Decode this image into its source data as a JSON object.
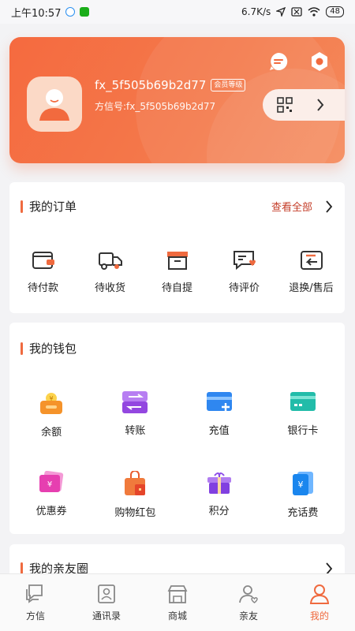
{
  "status_bar": {
    "time": "上午10:57",
    "speed": "6.7K/s",
    "battery": "48"
  },
  "profile": {
    "username": "fx_5f505b69b2d77",
    "member_tag": "会员等级",
    "id_line": "方信号:fx_5f505b69b2d77"
  },
  "orders": {
    "title": "我的订单",
    "view_all": "查看全部",
    "items": [
      {
        "label": "待付款",
        "icon": "wallet-icon"
      },
      {
        "label": "待收货",
        "icon": "delivery-truck-icon"
      },
      {
        "label": "待自提",
        "icon": "box-icon"
      },
      {
        "label": "待评价",
        "icon": "review-heart-icon"
      },
      {
        "label": "退换/售后",
        "icon": "return-icon"
      }
    ]
  },
  "wallet": {
    "title": "我的钱包",
    "items": [
      {
        "label": "余额",
        "icon": "balance-wallet-icon",
        "color": "#f5a623"
      },
      {
        "label": "转账",
        "icon": "transfer-icon",
        "color": "#a155e6"
      },
      {
        "label": "充值",
        "icon": "recharge-card-icon",
        "color": "#3a8ef5"
      },
      {
        "label": "银行卡",
        "icon": "bank-card-icon",
        "color": "#2cc0b0"
      },
      {
        "label": "优惠券",
        "icon": "coupon-icon",
        "color": "#e44fb8"
      },
      {
        "label": "购物红包",
        "icon": "red-packet-icon",
        "color": "#f06a3a"
      },
      {
        "label": "积分",
        "icon": "points-gift-icon",
        "color": "#8d4de8"
      },
      {
        "label": "充话费",
        "icon": "phone-bill-icon",
        "color": "#1d8ff0"
      }
    ]
  },
  "family": {
    "title": "我的亲友圈"
  },
  "tabs": [
    {
      "label": "方信",
      "icon": "chat-icon"
    },
    {
      "label": "通讯录",
      "icon": "contacts-icon"
    },
    {
      "label": "商城",
      "icon": "store-icon"
    },
    {
      "label": "亲友",
      "icon": "friends-icon"
    },
    {
      "label": "我的",
      "icon": "profile-icon",
      "active": true
    }
  ],
  "colors": {
    "accent": "#ef6a3f",
    "view_all": "#c43d28"
  }
}
